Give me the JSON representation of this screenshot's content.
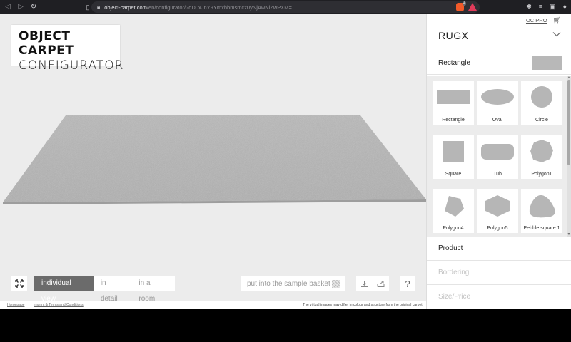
{
  "browser": {
    "url_host": "object-carpet.com",
    "url_path": "/en/configurator/?dD0xJnY9Ymxhbmsmcz0yNjAwNiZwPXM=",
    "brave_badge": "4"
  },
  "logo": {
    "line1": "OBJECT CARPET",
    "line2": "CONFIGURATOR"
  },
  "controls": {
    "views": [
      "individual view",
      "in detail",
      "in a room"
    ],
    "active_view": "individual view",
    "sample_basket_label": "put into the sample basket",
    "help_label": "?"
  },
  "panel": {
    "oc_pro_label": "OC PRO",
    "brand": "RUGX",
    "selected_shape": "Rectangle",
    "shapes": [
      "Rectangle",
      "Oval",
      "Circle",
      "Square",
      "Tub",
      "Polygon1",
      "Polygon4",
      "Polygon5",
      "Pebble square 1"
    ],
    "sections": {
      "product": "Product",
      "bordering": "Bordering",
      "size_price": "Size/Price"
    }
  },
  "footer": {
    "homepage": "Homepage",
    "imprint": "Imprint & Terms and Conditions",
    "note": "The virtual images may differ in colour and structure from the original carpet."
  },
  "colors": {
    "rug": "#b4b4b4",
    "stage": "#ececec",
    "active_view_bg": "#6b6b6b"
  }
}
